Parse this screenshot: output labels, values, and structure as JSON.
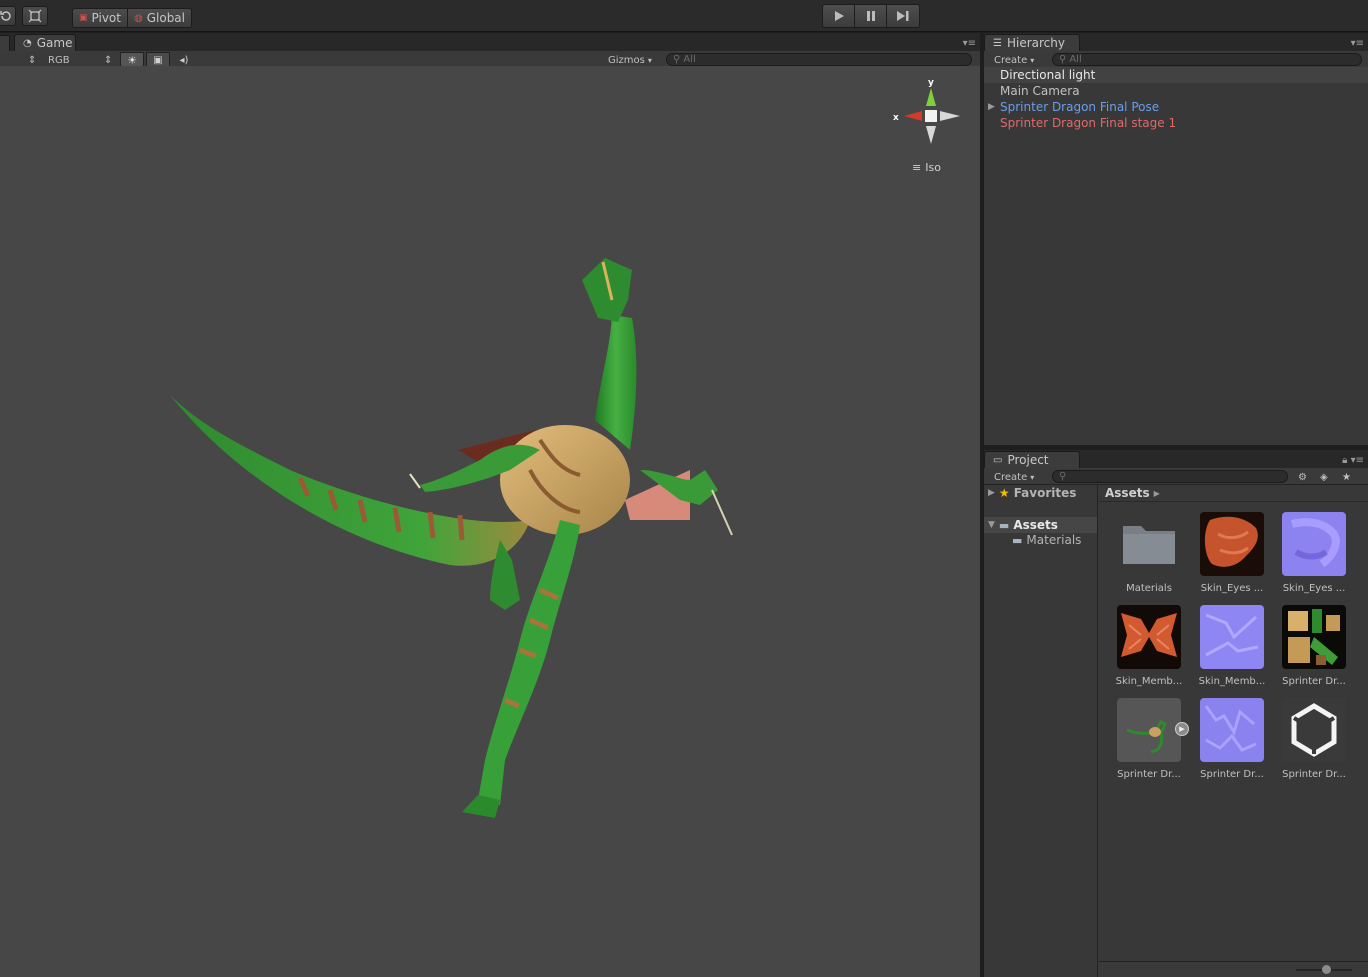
{
  "toolbar": {
    "pivot_label": "Pivot",
    "global_label": "Global"
  },
  "game": {
    "tab_label": "Game",
    "color_mode": "RGB",
    "gizmos_label": "Gizmos",
    "search_placeholder": "All",
    "iso_label": "Iso",
    "axis_y": "y",
    "axis_x": "x"
  },
  "hierarchy": {
    "tab_label": "Hierarchy",
    "create_label": "Create",
    "search_placeholder": "All",
    "items": [
      {
        "label": "Directional light",
        "color": "#e8e8e8"
      },
      {
        "label": "Main Camera",
        "color": "#c2c2c2"
      },
      {
        "label": "Sprinter Dragon Final Pose",
        "color": "#6b9ee8"
      },
      {
        "label": "Sprinter Dragon Final stage 1",
        "color": "#e06a6a"
      }
    ]
  },
  "project": {
    "tab_label": "Project",
    "create_label": "Create",
    "favorites_label": "Favorites",
    "assets_label": "Assets",
    "materials_label": "Materials",
    "breadcrumb": "Assets",
    "assets": [
      {
        "label": "Materials",
        "icon": "folder-icon"
      },
      {
        "label": "Skin_Eyes ...",
        "icon": "texture-orange-icon"
      },
      {
        "label": "Skin_Eyes ...",
        "icon": "normalmap-icon"
      },
      {
        "label": "Skin_Memb...",
        "icon": "texture-orange-icon"
      },
      {
        "label": "Skin_Memb...",
        "icon": "normalmap-icon"
      },
      {
        "label": "Sprinter Dr...",
        "icon": "texture-dragon-icon"
      },
      {
        "label": "Sprinter Dr...",
        "icon": "model-prefab-icon"
      },
      {
        "label": "Sprinter Dr...",
        "icon": "normalmap-icon"
      },
      {
        "label": "Sprinter Dr...",
        "icon": "unity-logo-icon"
      }
    ]
  }
}
